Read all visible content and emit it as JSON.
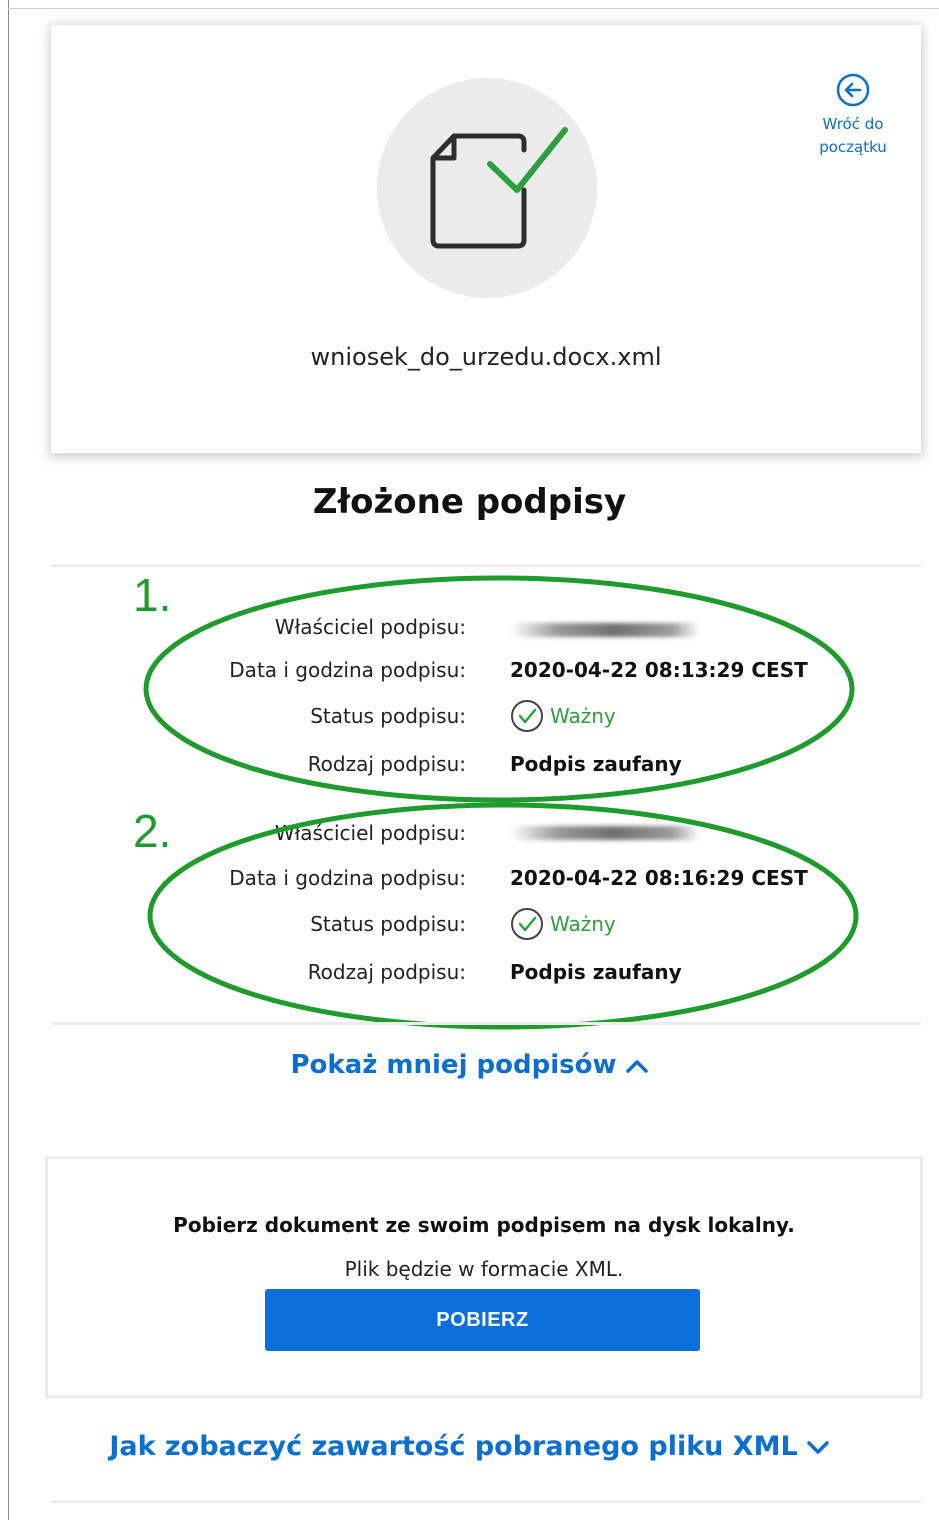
{
  "file": {
    "name": "wniosek_do_urzedu.docx.xml",
    "back_label_line1": "Wróć do",
    "back_label_line2": "początku"
  },
  "signatures_section": {
    "title": "Złożone podpisy",
    "signatures": [
      {
        "owner_label": "Właściciel podpisu:",
        "datetime_label": "Data i godzina podpisu:",
        "datetime": "2020-04-22 08:13:29 CEST",
        "status_label": "Status podpisu:",
        "status": "Ważny",
        "type_label": "Rodzaj podpisu:",
        "type": "Podpis zaufany"
      },
      {
        "owner_label": "Właściciel podpisu:",
        "datetime_label": "Data i godzina podpisu:",
        "datetime": "2020-04-22 08:16:29 CEST",
        "status_label": "Status podpisu:",
        "status": "Ważny",
        "type_label": "Rodzaj podpisu:",
        "type": "Podpis zaufany"
      }
    ],
    "annotations": [
      "1.",
      "2."
    ],
    "show_less_label": "Pokaż mniej podpisów"
  },
  "download": {
    "title": "Pobierz dokument ze swoim podpisem na dysk lokalny.",
    "subtitle": "Plik będzie w formacie XML.",
    "button_label": "POBIERZ"
  },
  "xml_help_label": "Jak zobaczyć zawartość pobranego pliku XML",
  "colors": {
    "link": "#0b6fcf",
    "button": "#0b6fdb",
    "valid": "#2e9f3e",
    "annotation": "#1f9a2c"
  }
}
